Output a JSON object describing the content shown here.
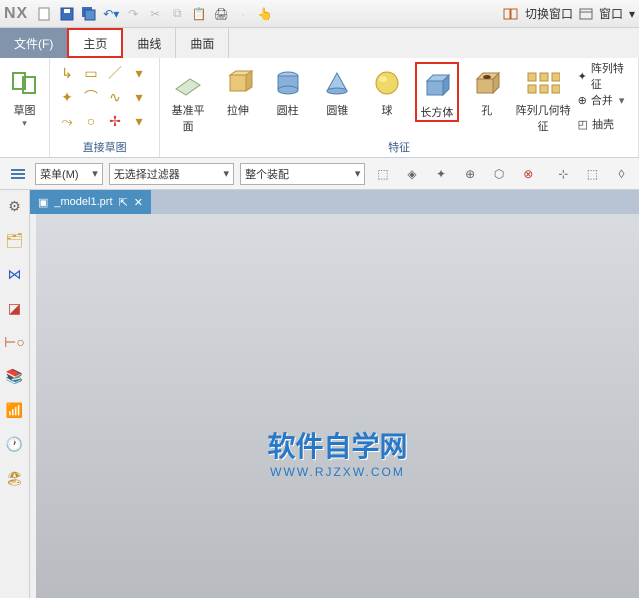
{
  "app": {
    "logo": "NX"
  },
  "qat": {
    "switch_window": "切换窗口",
    "window": "窗口"
  },
  "menu": {
    "file": "文件(F)",
    "tabs": [
      {
        "label": "主页",
        "active": true,
        "highlight": true
      },
      {
        "label": "曲线",
        "active": false,
        "highlight": false
      },
      {
        "label": "曲面",
        "active": false,
        "highlight": false
      }
    ]
  },
  "ribbon": {
    "groups": {
      "sketch": {
        "label": "草图",
        "btn": "草图"
      },
      "direct_sketch": {
        "label": "直接草图"
      },
      "feature": {
        "label": "特征",
        "items": {
          "datum_plane": "基准平面",
          "extrude": "拉伸",
          "cylinder": "圆柱",
          "cone": "圆锥",
          "sphere": "球",
          "block": "长方体",
          "hole": "孔",
          "pattern_geom": "阵列几何特征"
        },
        "side": {
          "pattern_feature": "阵列特征",
          "unite": "合并",
          "shell": "抽壳"
        }
      }
    }
  },
  "filterbar": {
    "menu_btn": "菜单(M)",
    "filter": "无选择过滤器",
    "scope": "整个装配"
  },
  "doc": {
    "tab": "_model1.prt"
  },
  "watermark": {
    "line1": "软件自学网",
    "line2": "WWW.RJZXW.COM"
  }
}
